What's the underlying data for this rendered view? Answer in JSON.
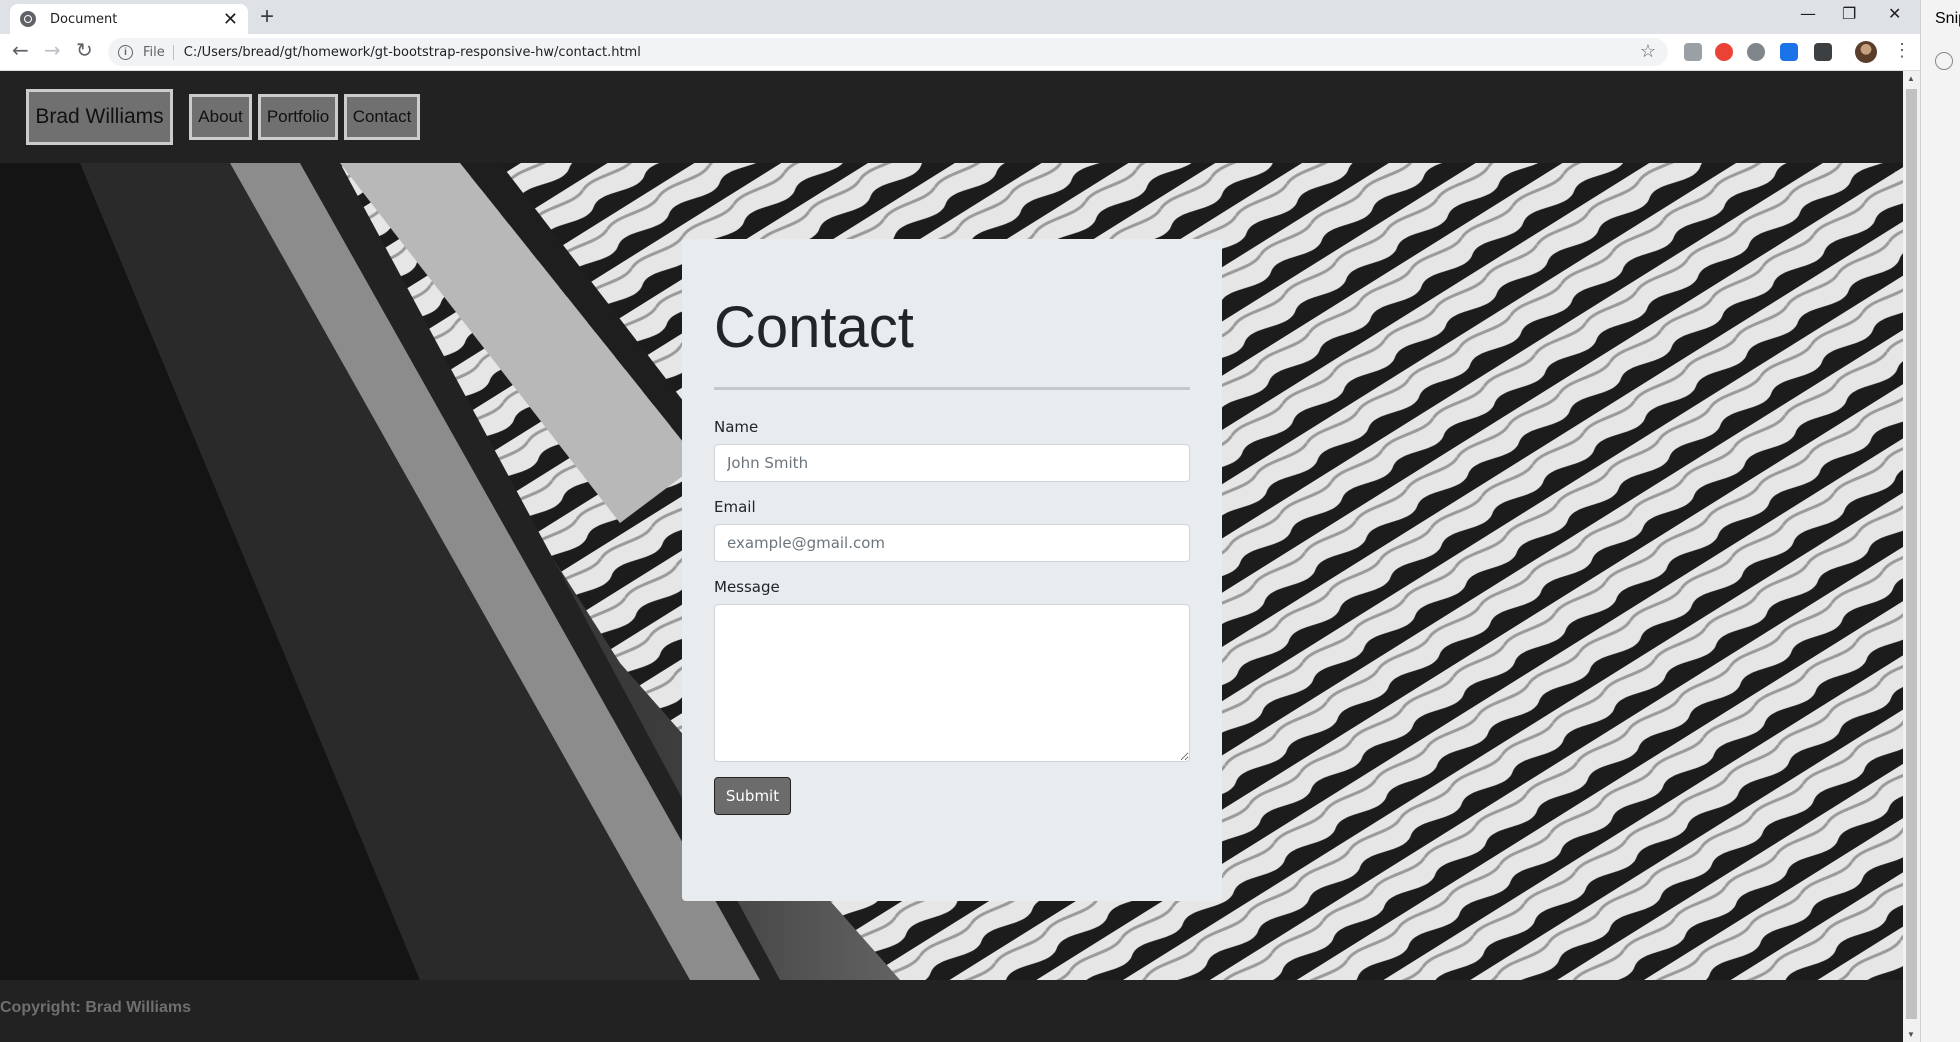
{
  "browser": {
    "tab_title": "Document",
    "new_tab": "+",
    "tab_close": "✕",
    "window_controls": {
      "minimize": "—",
      "restore": "❐",
      "close": "✕"
    },
    "nav": {
      "back": "←",
      "forward": "→",
      "reload": "↻"
    },
    "address_scheme": "File",
    "address_url": "C:/Users/bread/gt/homework/gt-bootstrap-responsive-hw/contact.html",
    "info_glyph": "i",
    "star": "☆",
    "menu": "⋮",
    "side_app_label": "Snip"
  },
  "site": {
    "brand": "Brad Williams",
    "nav_links": [
      "About",
      "Portfolio",
      "Contact"
    ],
    "contact": {
      "title": "Contact",
      "name_label": "Name",
      "name_placeholder": "John Smith",
      "email_label": "Email",
      "email_placeholder": "example@gmail.com",
      "message_label": "Message",
      "message_value": "",
      "submit_label": "Submit"
    },
    "footer": "Copyright: Brad Williams"
  },
  "colors": {
    "nav_bg": "#222222",
    "card_bg": "#e9ecef",
    "button_bg": "#6c6c6c"
  }
}
